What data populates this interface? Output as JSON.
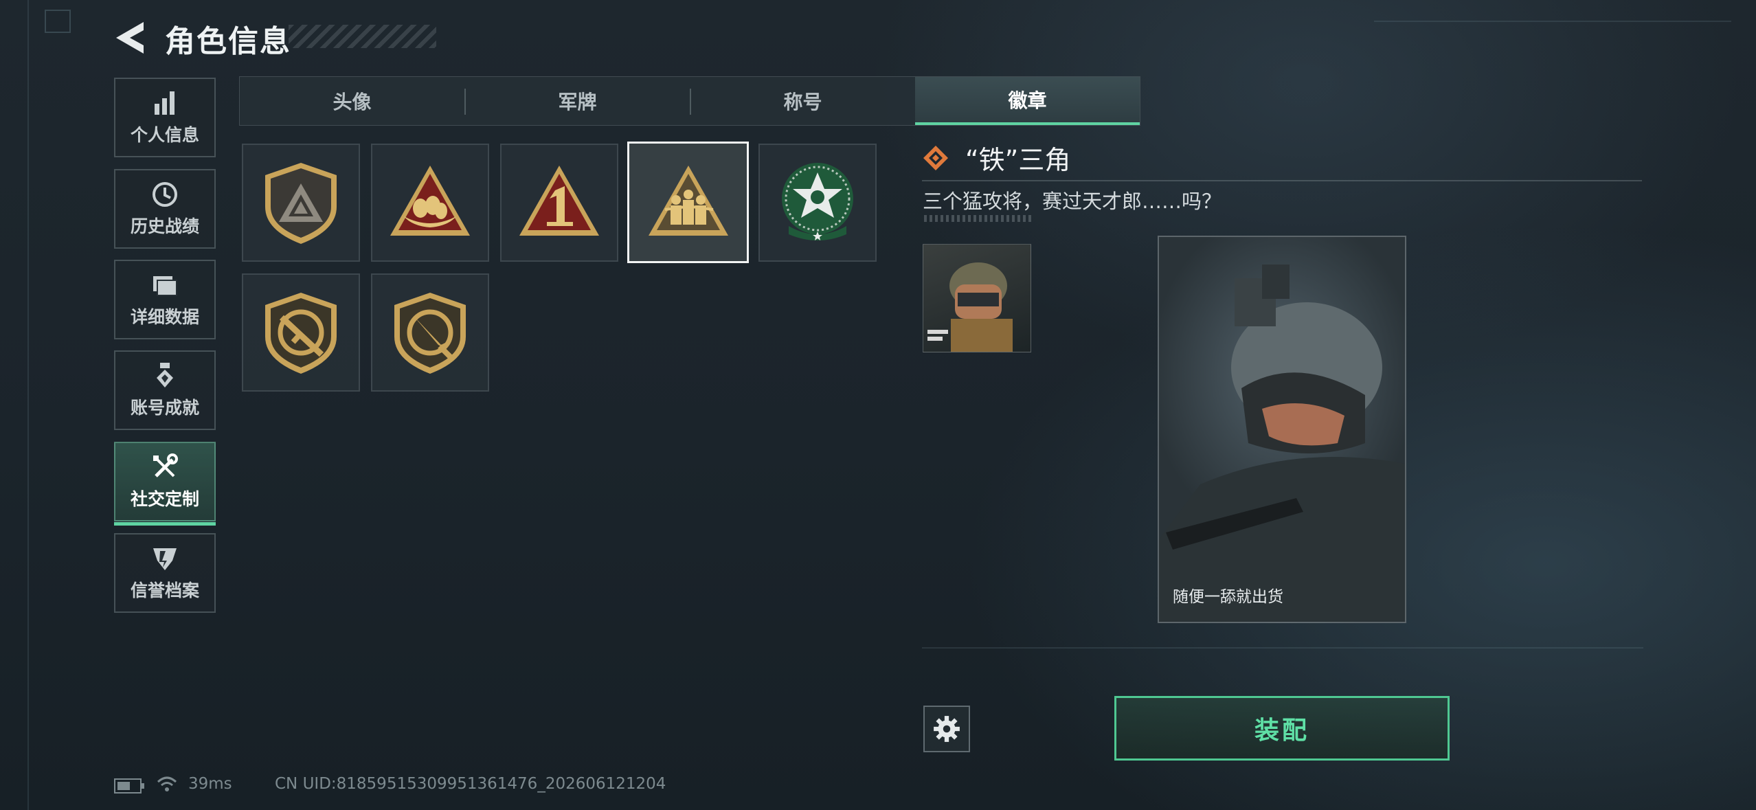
{
  "header": {
    "title": "角色信息"
  },
  "sidebar": {
    "items": [
      {
        "label": "个人信息",
        "icon": "bar-chart-icon"
      },
      {
        "label": "历史战绩",
        "icon": "history-clock-icon"
      },
      {
        "label": "详细数据",
        "icon": "folder-icon"
      },
      {
        "label": "账号成就",
        "icon": "medal-icon"
      },
      {
        "label": "社交定制",
        "icon": "wrench-screwdriver-icon",
        "active": true
      },
      {
        "label": "信誉档案",
        "icon": "shield-emblem-icon"
      }
    ]
  },
  "tabs": [
    {
      "label": "头像"
    },
    {
      "label": "军牌"
    },
    {
      "label": "称号"
    },
    {
      "label": "徽章",
      "active": true
    }
  ],
  "badges": [
    {
      "name": "triangle-shield-badge"
    },
    {
      "name": "nest-eggs-badge"
    },
    {
      "name": "number-one-badge"
    },
    {
      "name": "iron-triangle-soldiers-badge",
      "selected": true
    },
    {
      "name": "green-star-badge"
    },
    {
      "name": "rifle-shield-badge"
    },
    {
      "name": "knife-shield-badge"
    }
  ],
  "detail": {
    "title": "“铁”三角",
    "description": "三个猛攻将，赛过天才郎……吗？",
    "card_caption": "随便一舔就出货"
  },
  "actions": {
    "equip_label": "装配"
  },
  "status": {
    "ping": "39ms",
    "uid": "CN UID:8185951530995136147​6_202606121204"
  },
  "colors": {
    "accent": "#5fd3a2",
    "equip_text": "#5fe0a6",
    "badge_gold": "#c9a45a",
    "badge_red": "#7a1f1c"
  }
}
